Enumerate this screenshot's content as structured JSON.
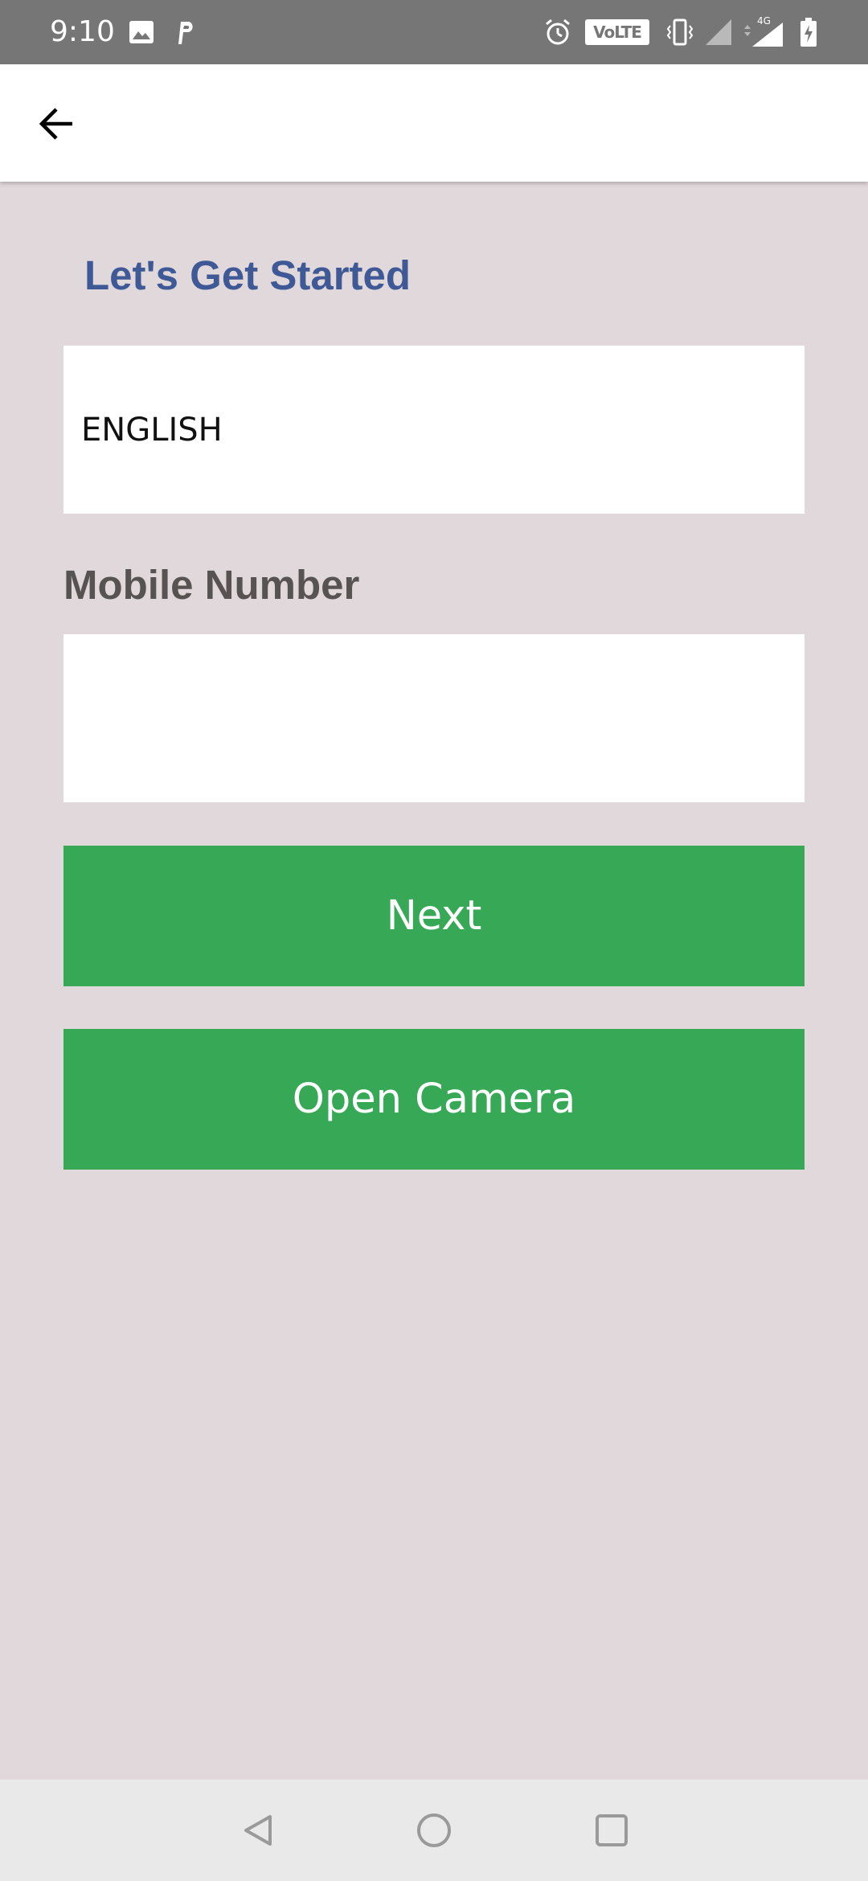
{
  "status_bar": {
    "time": "9:10",
    "network_badge": "VoLTE",
    "network_type": "4G",
    "icons": [
      "image-icon",
      "parking-app-icon",
      "alarm-icon",
      "volte-icon",
      "vibrate-icon",
      "signal-icon",
      "signal-4g-icon",
      "battery-charging-icon"
    ]
  },
  "app_bar": {
    "back_icon": "arrow-left-icon"
  },
  "main": {
    "title": "Let's Get Started",
    "language_value": "ENGLISH",
    "mobile_label": "Mobile Number",
    "mobile_value": "",
    "next_label": "Next",
    "camera_label": "Open Camera"
  },
  "nav_bar": {
    "icons": [
      "back-triangle-icon",
      "home-circle-icon",
      "recents-square-icon"
    ]
  },
  "colors": {
    "title": "#3f5896",
    "button": "#37a956",
    "background": "#e0d8da",
    "status_bar": "#767676"
  }
}
